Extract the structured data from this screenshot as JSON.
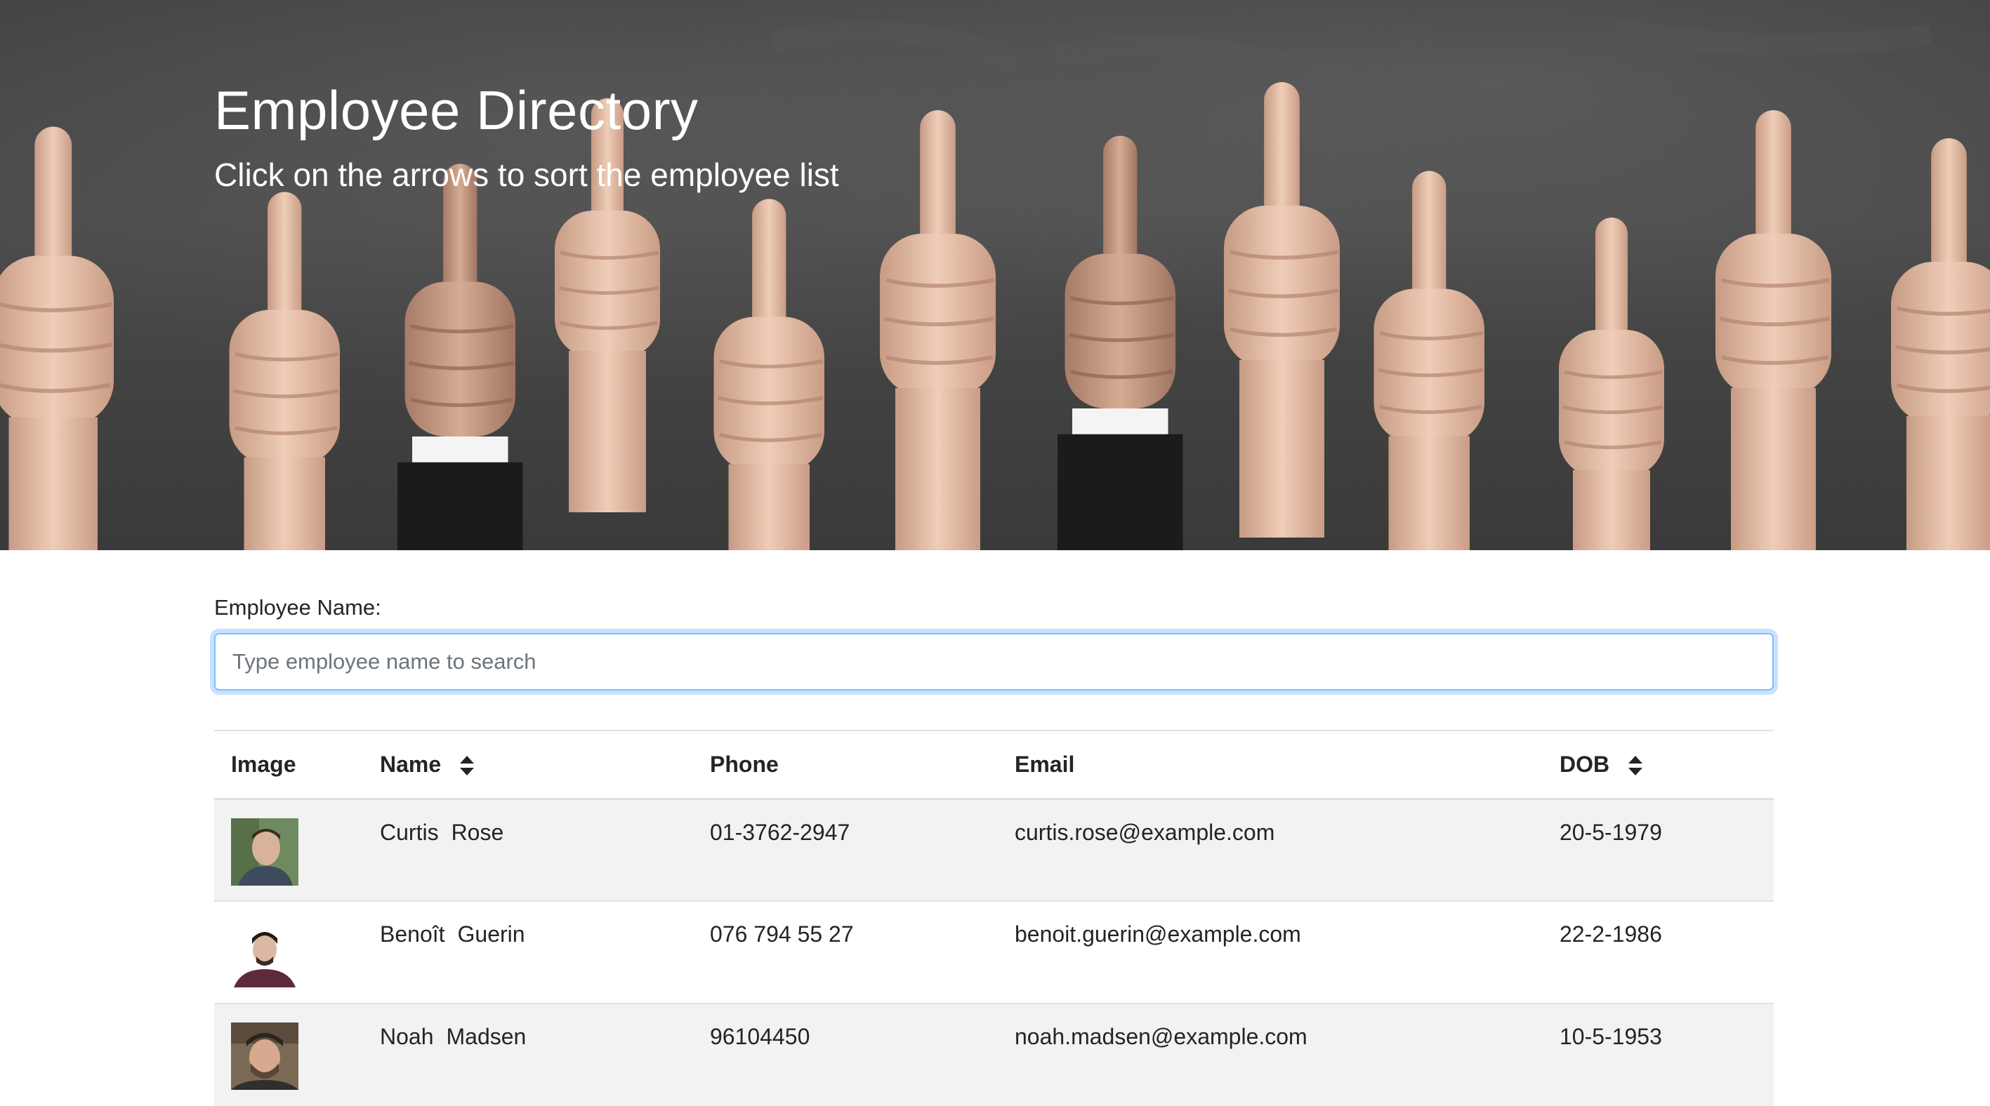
{
  "header": {
    "title": "Employee Directory",
    "subtitle": "Click on the arrows to sort the employee list"
  },
  "search": {
    "label": "Employee Name:",
    "placeholder": "Type employee name to search",
    "value": ""
  },
  "table": {
    "columns": {
      "image": "Image",
      "name": "Name",
      "phone": "Phone",
      "email": "Email",
      "dob": "DOB"
    },
    "rows": [
      {
        "first": "Curtis",
        "last": "Rose",
        "phone": "01-3762-2947",
        "email": "curtis.rose@example.com",
        "dob": "20-5-1979"
      },
      {
        "first": "Benoît",
        "last": "Guerin",
        "phone": "076 794 55 27",
        "email": "benoit.guerin@example.com",
        "dob": "22-2-1986"
      },
      {
        "first": "Noah",
        "last": "Madsen",
        "phone": "96104450",
        "email": "noah.madsen@example.com",
        "dob": "10-5-1953"
      }
    ]
  },
  "icons": {
    "sort": "sort-icon",
    "avatar": "person-photo"
  },
  "colors": {
    "focus_border": "#80bdff",
    "row_stripe": "#f2f2f2",
    "hero_bg": "#404040"
  }
}
